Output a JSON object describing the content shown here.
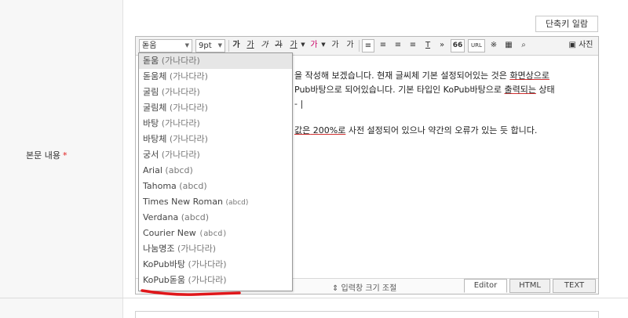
{
  "form": {
    "label": "본문 내용",
    "required_mark": "*",
    "hotkey_button": "단축키 일람"
  },
  "toolbar": {
    "font_select": "돋움",
    "size_select": "9pt",
    "bold": "가",
    "underline": "가",
    "italic": "가",
    "strike": "가",
    "font_color": "가",
    "bg_color": "가",
    "superscript": "가",
    "subscript": "가",
    "align_left": "≡",
    "align_center": "≡",
    "align_right": "≡",
    "justify": "≡",
    "clear_format": "T",
    "more": "»",
    "quote": "66",
    "url": "URL",
    "special_char": "※",
    "table": "▦",
    "search": "⌕",
    "photo": "사진"
  },
  "content": {
    "line1_a": "을 작성해 보겠습니다. 현재 글씨체 기본 설정되어있는 것은 ",
    "line1_u": "화면상으로",
    "line2_a": "Pub바탕으로 되어있습니다. 기본 타입인 KoPub바탕으로 ",
    "line2_u": "출력되는",
    "line2_b": " 상태",
    "line3": "- |",
    "line5_u": "값은",
    "line5_a": " 200%로",
    "line5_b": " 사전 설정되어 있으나 약간의 오류가 있는 듯 합니다."
  },
  "status": {
    "resize": "⇕ 입력창 크기 조절",
    "tabs": [
      "Editor",
      "HTML",
      "TEXT"
    ]
  },
  "dropdown": {
    "items": [
      {
        "name": "돋움",
        "sample": "(가나다라)"
      },
      {
        "name": "돋움체",
        "sample": "(가나다라)"
      },
      {
        "name": "굴림",
        "sample": "(가나다라)"
      },
      {
        "name": "굴림체",
        "sample": "(가나다라)"
      },
      {
        "name": "바탕",
        "sample": "(가나다라)"
      },
      {
        "name": "바탕체",
        "sample": "(가나다라)"
      },
      {
        "name": "궁서",
        "sample": "(가나다라)"
      },
      {
        "name": "Arial",
        "sample": "(abcd)"
      },
      {
        "name": "Tahoma",
        "sample": "(abcd)"
      },
      {
        "name": "Times New Roman",
        "sample": "(abcd)"
      },
      {
        "name": "Verdana",
        "sample": "(abcd)"
      },
      {
        "name": "Courier New",
        "sample": "(abcd)"
      },
      {
        "name": "나눔명조",
        "sample": "(가나다라)"
      },
      {
        "name": "KoPub바탕",
        "sample": "(가나다라)"
      },
      {
        "name": "KoPub돋움",
        "sample": "(가나다라)"
      }
    ]
  },
  "colors": {
    "required": "#e02020",
    "annotation": "#e0161a",
    "selected_row": "#e6e6e6"
  }
}
